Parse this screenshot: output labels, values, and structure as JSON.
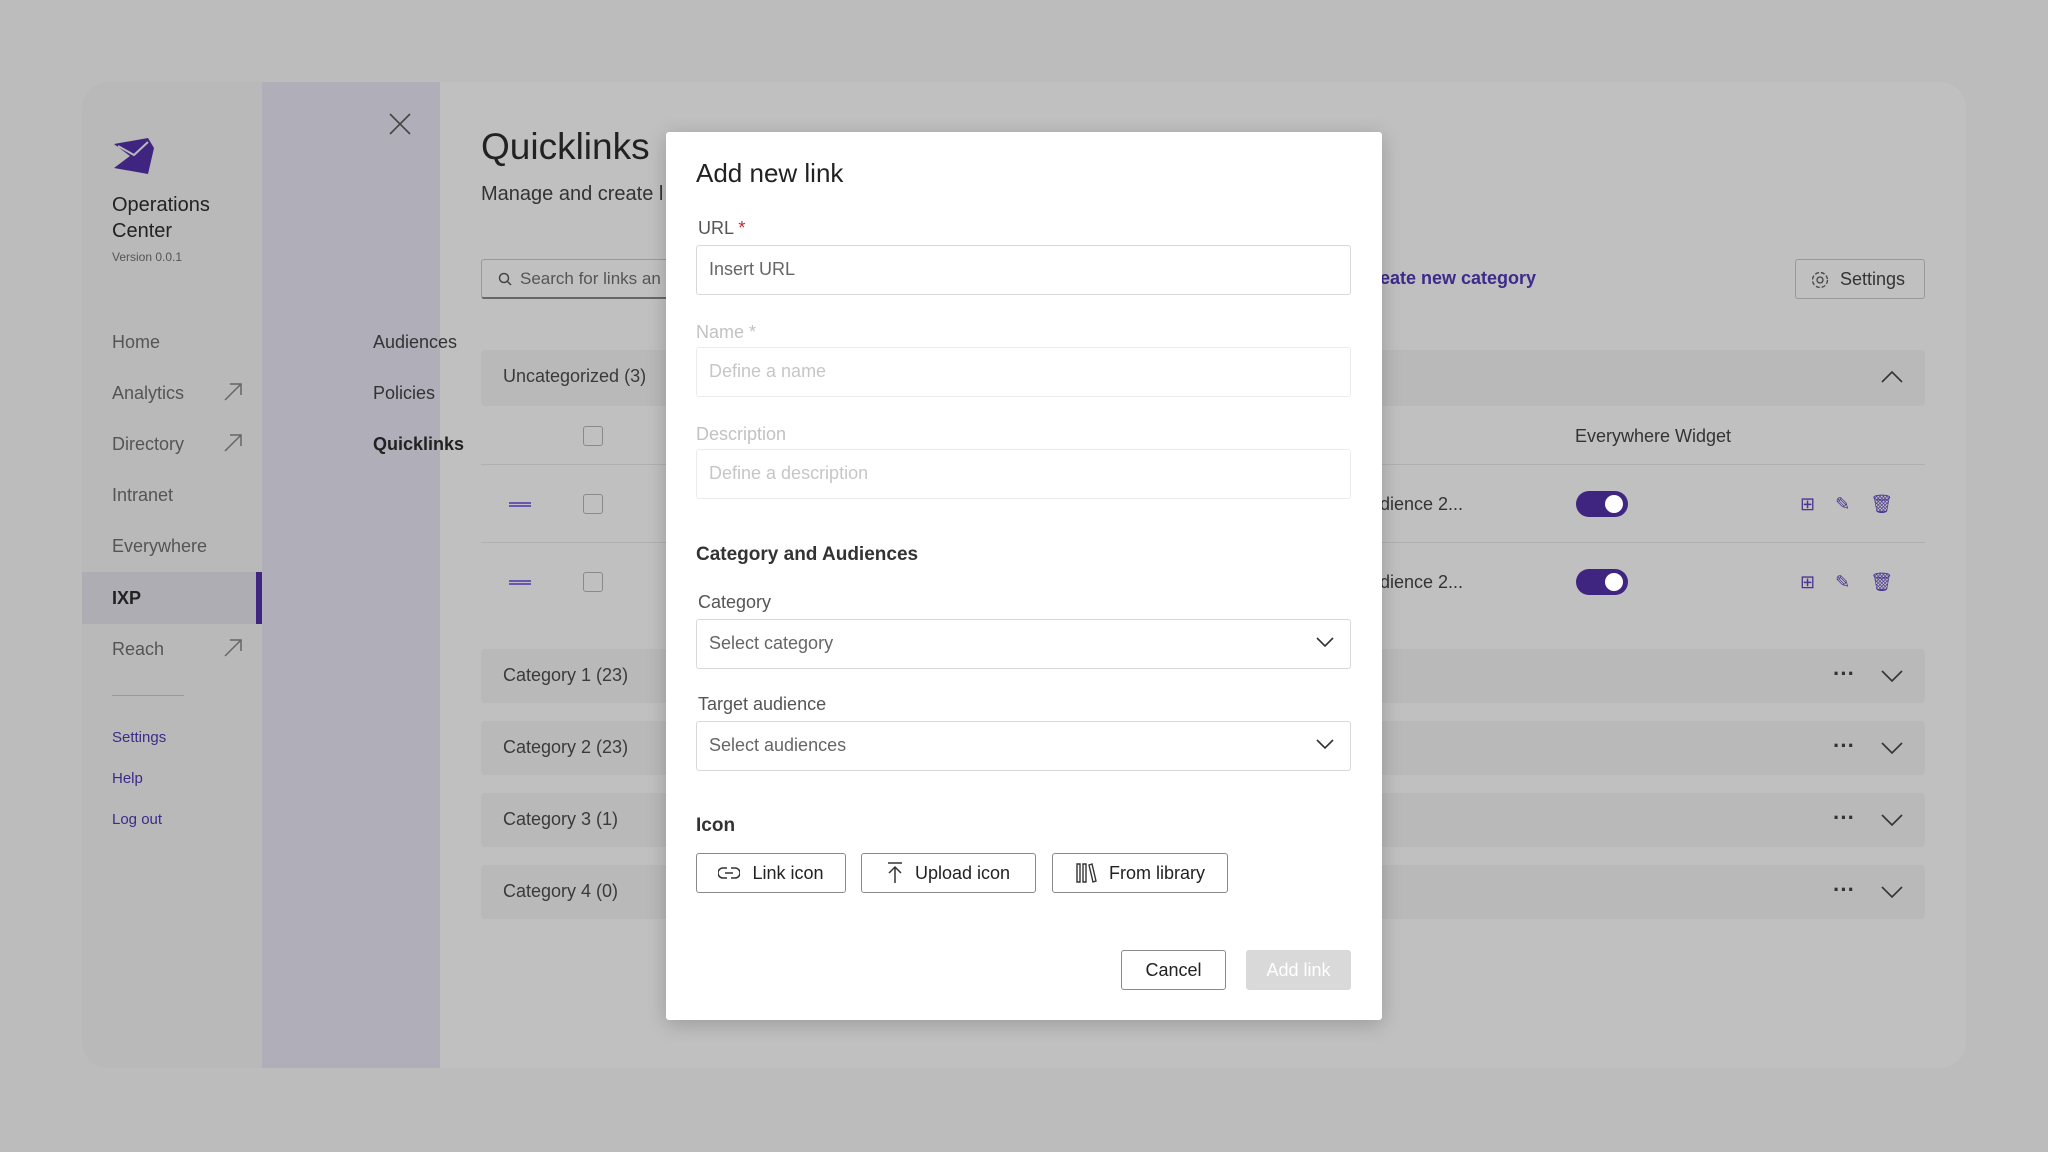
{
  "app": {
    "name_line1": "Operations",
    "name_line2": "Center",
    "version": "Version 0.0.1",
    "brand_color": "#3f2480"
  },
  "sidebar": {
    "items": [
      {
        "label": "Home"
      },
      {
        "label": "Analytics",
        "external": true
      },
      {
        "label": "Directory",
        "external": true
      },
      {
        "label": "Intranet"
      },
      {
        "label": "Everywhere"
      },
      {
        "label": "IXP",
        "active": true
      },
      {
        "label": "Reach",
        "external": true
      }
    ],
    "links": [
      "Settings",
      "Help",
      "Log out"
    ]
  },
  "subnav": {
    "items": [
      "Audiences",
      "Policies",
      "Quicklinks"
    ],
    "active": "Quicklinks"
  },
  "page": {
    "title": "Quicklinks",
    "subtitle": "Manage and create l",
    "search_placeholder": "Search for links an",
    "create_category": "eate new category",
    "settings_label": "Settings"
  },
  "table": {
    "uncategorized": "Uncategorized (3)",
    "col_widget": "Everywhere Widget",
    "rows": [
      {
        "audience": "dience 2...",
        "widget_on": true
      },
      {
        "audience": "dience 2...",
        "widget_on": true
      }
    ]
  },
  "categories": [
    "Category 1 (23)",
    "Category 2 (23)",
    "Category 3 (1)",
    "Category 4 (0)"
  ],
  "modal": {
    "title": "Add new link",
    "url_label": "URL",
    "required": "*",
    "url_placeholder": "Insert URL",
    "name_label": "Name *",
    "name_placeholder": "Define a name",
    "desc_label": "Description",
    "desc_placeholder": "Define a description",
    "section_cat": "Category and Audiences",
    "category_label": "Category",
    "category_placeholder": "Select category",
    "audience_label": "Target audience",
    "audience_placeholder": "Select audiences",
    "icon_heading": "Icon",
    "link_icon": "Link icon",
    "upload_icon": "Upload icon",
    "from_library": "From library",
    "cancel": "Cancel",
    "add": "Add link"
  }
}
